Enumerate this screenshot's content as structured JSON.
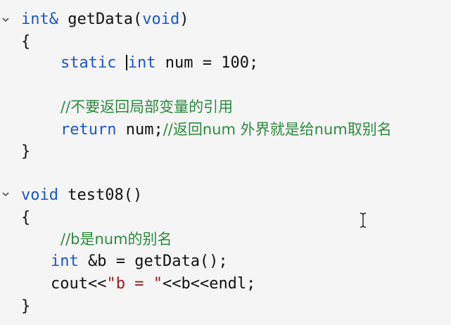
{
  "code": {
    "fn1_sig": {
      "type": "int&",
      "name": "getData(",
      "param": "void",
      "close": ")"
    },
    "fn1_open": "{",
    "l_static": {
      "kw": "static",
      "type": "int",
      "rest": " num = ",
      "val": "100",
      "semi": ";"
    },
    "l_comment1": "//不要返回局部变量的引用",
    "l_return": {
      "kw": "return",
      "rest": " num;",
      "comment": "//返回num 外界就是给num取别名"
    },
    "fn1_close": "}",
    "fn2_sig": {
      "type": "void",
      "name": " test08()"
    },
    "fn2_open": "{",
    "l_comment2": "//b是num的别名",
    "l_int": {
      "type": "int",
      "rest": " &b = getData();"
    },
    "l_cout": {
      "pre": "cout<<",
      "str": "\"b = \"",
      "post": "<<b<<endl;"
    },
    "fn2_close": "}"
  },
  "colors": {
    "keyword": "#1b57c4",
    "comment": "#2c8a3d",
    "string": "#a4161f",
    "background": "#f5f5f5"
  },
  "icons": [
    "fold-chevron-icon",
    "text-cursor-icon"
  ]
}
